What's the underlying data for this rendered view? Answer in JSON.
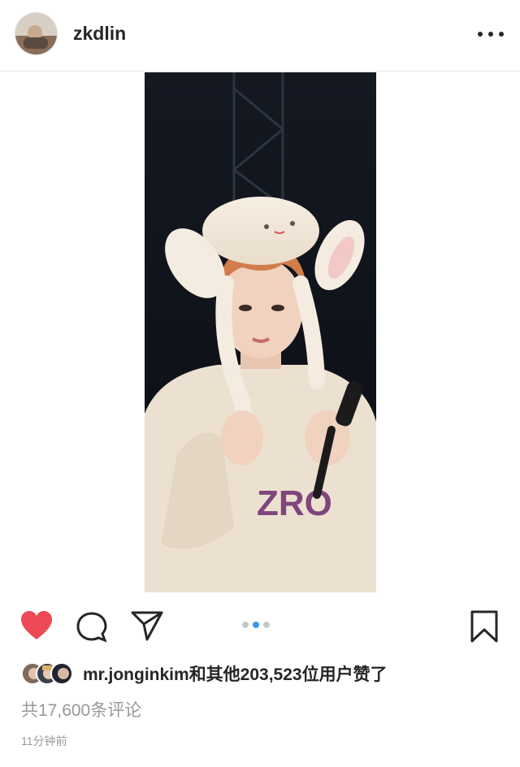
{
  "post": {
    "username": "zkdlin",
    "likes_user": "mr.jonginkim",
    "likes_rest": "和其他203,523位用户赞了",
    "comments": "共17,600条评论",
    "time": "11分钟前"
  },
  "carousel": {
    "count": 3,
    "active_index": 1
  },
  "colors": {
    "like_heart": "#ed4956",
    "dot_active": "#3897f0",
    "dot_inactive": "#c7c7c7"
  },
  "icons": [
    "more-icon",
    "heart-icon",
    "comment-icon",
    "share-icon",
    "bookmark-icon"
  ]
}
